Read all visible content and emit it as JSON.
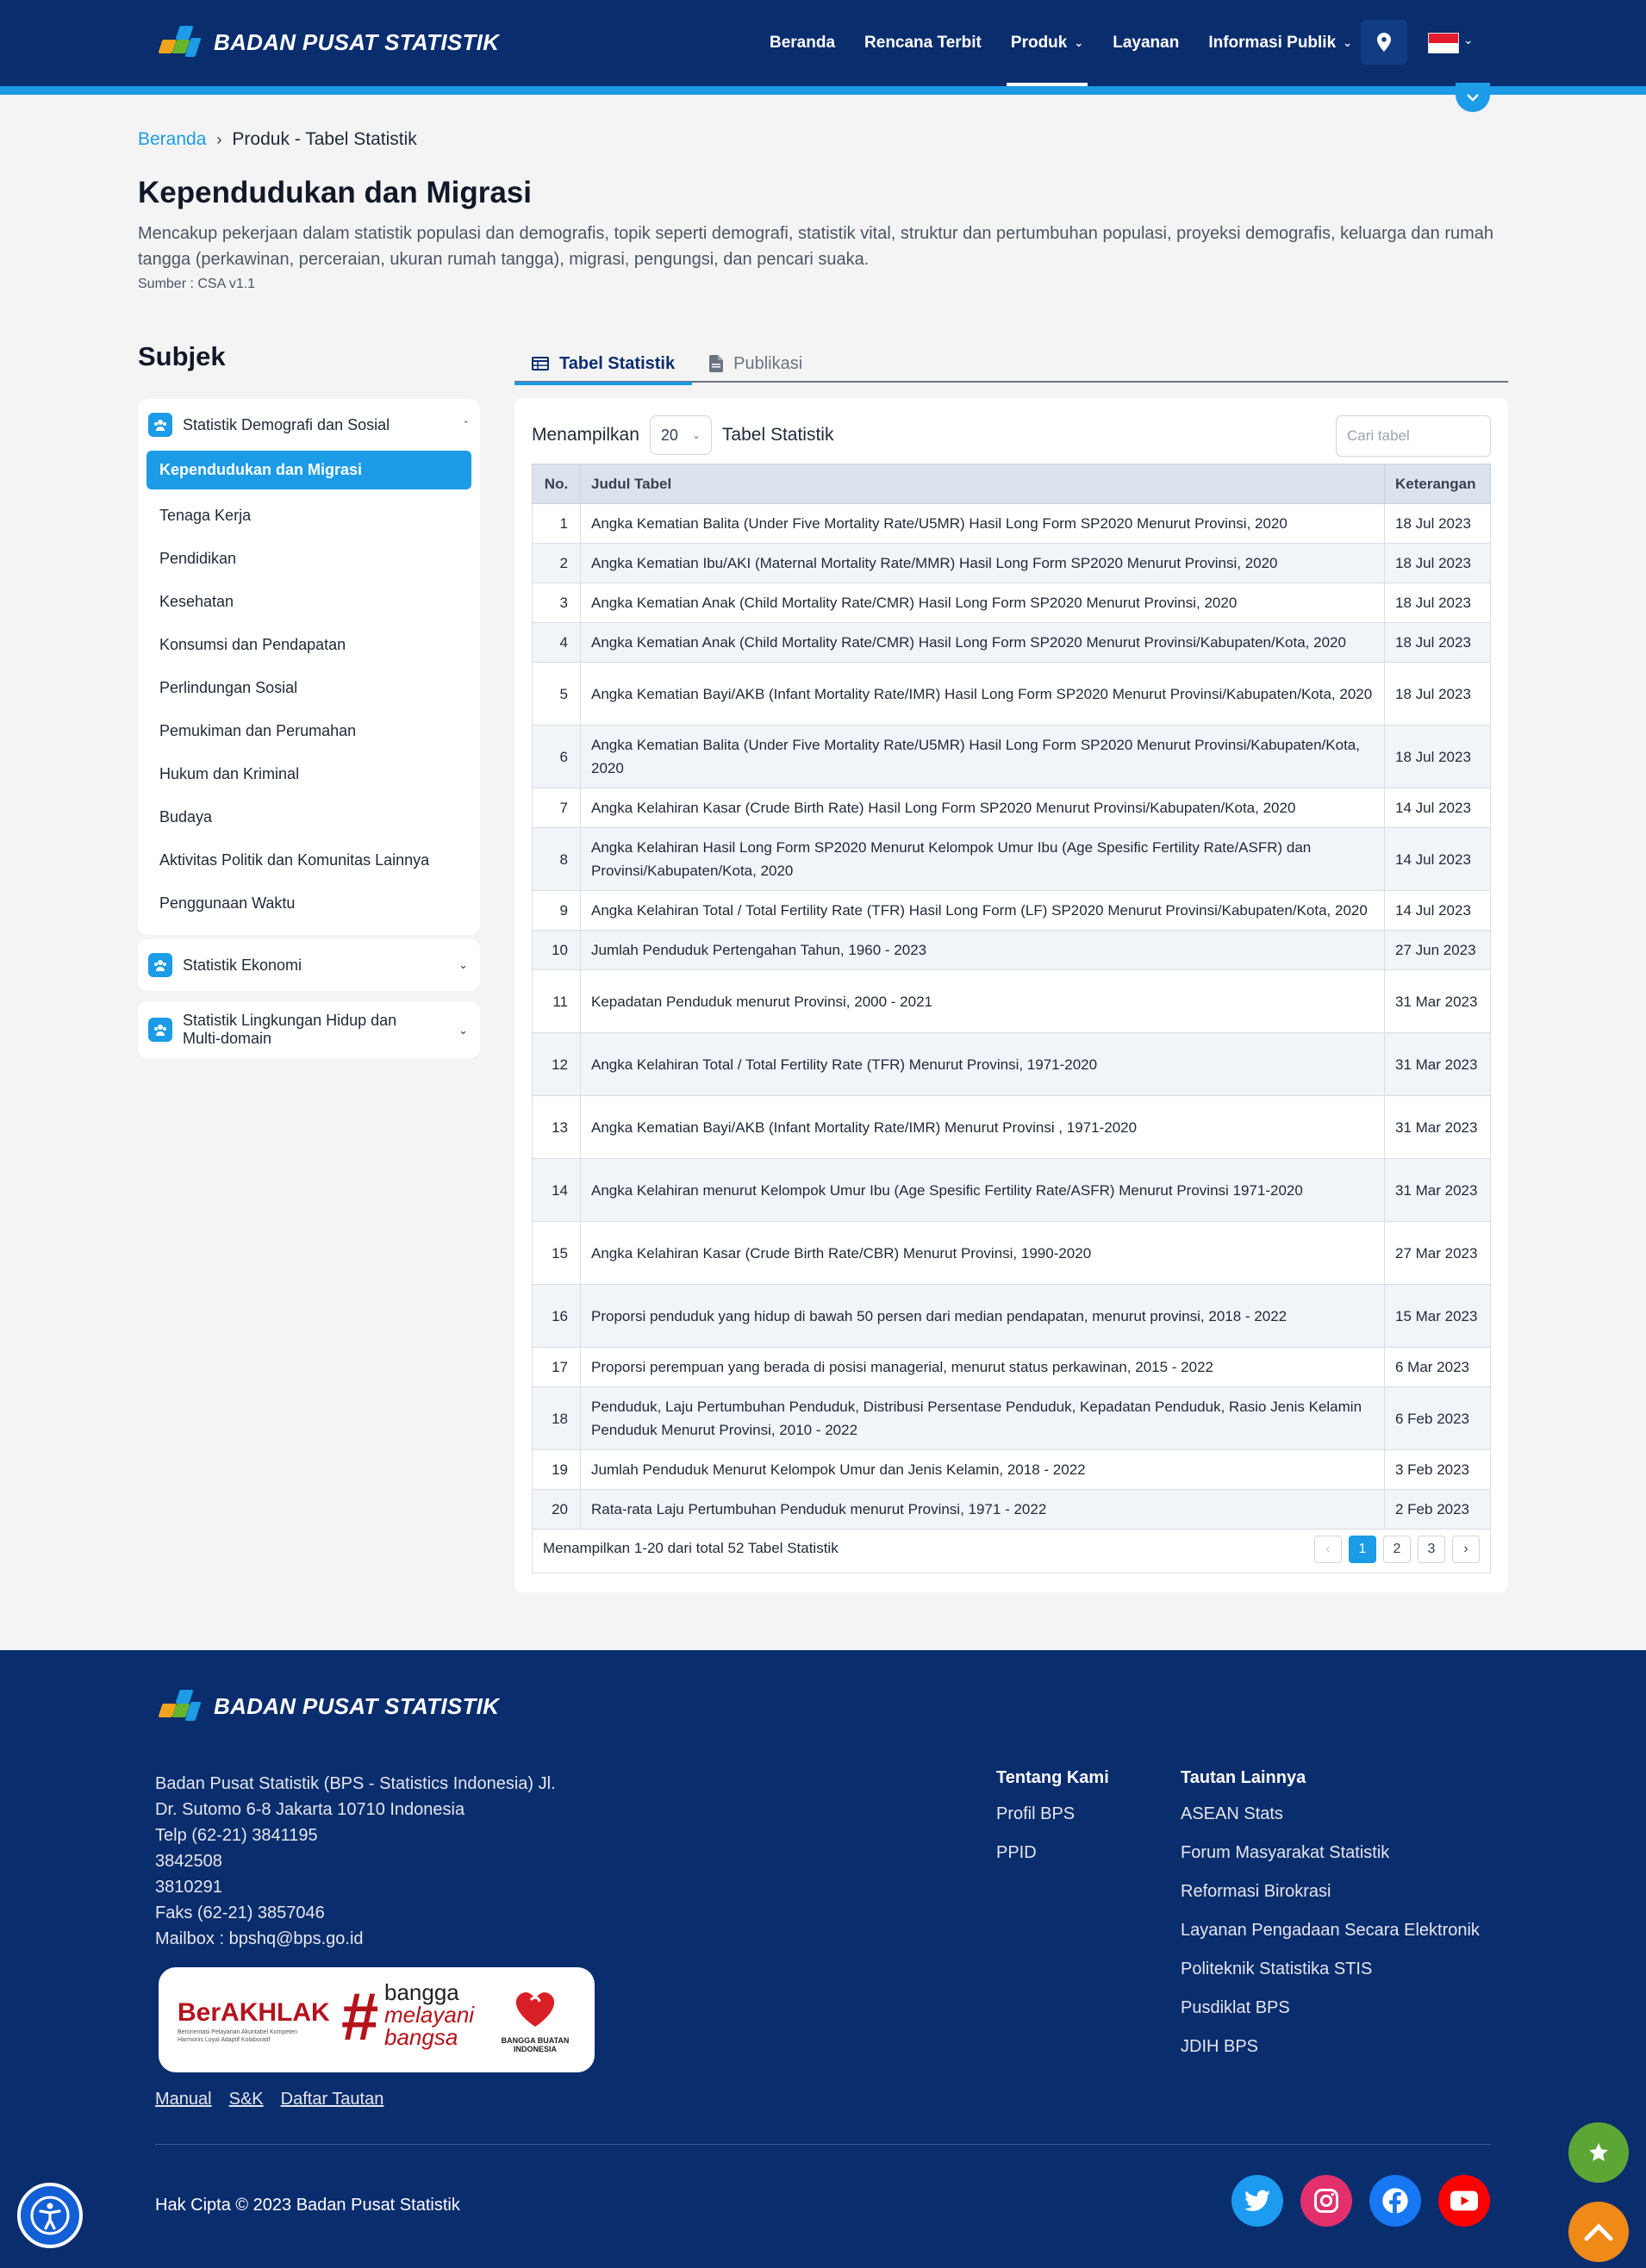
{
  "brand": {
    "name": "BADAN PUSAT STATISTIK"
  },
  "nav": {
    "items": [
      {
        "label": "Beranda"
      },
      {
        "label": "Rencana Terbit"
      },
      {
        "label": "Produk",
        "dropdown": true,
        "active": true
      },
      {
        "label": "Layanan"
      },
      {
        "label": "Informasi Publik",
        "dropdown": true
      }
    ],
    "language_flag": "indonesia-flag-icon"
  },
  "breadcrumb": {
    "home": "Beranda",
    "current": "Produk - Tabel Statistik"
  },
  "page": {
    "title": "Kependudukan dan Migrasi",
    "description": "Mencakup pekerjaan dalam statistik populasi dan demografis, topik seperti demografi, statistik vital, struktur dan pertumbuhan populasi, proyeksi demografis, keluarga dan rumah tangga (perkawinan, perceraian, ukuran rumah tangga), migrasi, pengungsi, dan pencari suaka.",
    "source": "Sumber : CSA v1.1"
  },
  "sidebar": {
    "title": "Subjek",
    "groups": [
      {
        "label": "Statistik Demografi dan Sosial",
        "expanded": true,
        "items": [
          {
            "label": "Kependudukan dan Migrasi",
            "active": true
          },
          {
            "label": "Tenaga Kerja"
          },
          {
            "label": "Pendidikan"
          },
          {
            "label": "Kesehatan"
          },
          {
            "label": "Konsumsi dan Pendapatan"
          },
          {
            "label": "Perlindungan Sosial"
          },
          {
            "label": "Pemukiman dan Perumahan"
          },
          {
            "label": "Hukum dan Kriminal"
          },
          {
            "label": "Budaya"
          },
          {
            "label": "Aktivitas Politik dan Komunitas Lainnya"
          },
          {
            "label": "Penggunaan Waktu"
          }
        ]
      },
      {
        "label": "Statistik Ekonomi",
        "expanded": false
      },
      {
        "label": "Statistik Lingkungan Hidup dan Multi-domain",
        "expanded": false
      }
    ]
  },
  "tabs": [
    {
      "label": "Tabel Statistik",
      "active": true
    },
    {
      "label": "Publikasi"
    }
  ],
  "table_controls": {
    "show_label": "Menampilkan",
    "per_page": "20",
    "suffix": "Tabel Statistik",
    "search_placeholder": "Cari tabel"
  },
  "table": {
    "headers": [
      "No.",
      "Judul Tabel",
      "Keterangan"
    ],
    "rows": [
      {
        "no": "1",
        "title": "Angka Kematian Balita (Under Five Mortality Rate/U5MR) Hasil Long Form SP2020 Menurut Provinsi, 2020",
        "date": "18 Jul 2023"
      },
      {
        "no": "2",
        "title": "Angka Kematian Ibu/AKI (Maternal Mortality Rate/MMR) Hasil Long Form SP2020 Menurut Provinsi, 2020",
        "date": "18 Jul 2023"
      },
      {
        "no": "3",
        "title": "Angka Kematian Anak (Child Mortality Rate/CMR) Hasil Long Form SP2020 Menurut Provinsi, 2020",
        "date": "18 Jul 2023"
      },
      {
        "no": "4",
        "title": "Angka Kematian Anak (Child Mortality Rate/CMR) Hasil Long Form SP2020 Menurut Provinsi/Kabupaten/Kota, 2020",
        "date": "18 Jul 2023"
      },
      {
        "no": "5",
        "title": "Angka Kematian Bayi/AKB (Infant Mortality Rate/IMR) Hasil Long Form SP2020 Menurut Provinsi/Kabupaten/Kota, 2020",
        "date": "18 Jul 2023"
      },
      {
        "no": "6",
        "title": "Angka Kematian Balita (Under Five Mortality Rate/U5MR) Hasil Long Form SP2020 Menurut Provinsi/Kabupaten/Kota, 2020",
        "date": "18 Jul 2023"
      },
      {
        "no": "7",
        "title": "Angka Kelahiran Kasar (Crude Birth Rate) Hasil Long Form SP2020 Menurut Provinsi/Kabupaten/Kota, 2020",
        "date": "14 Jul 2023"
      },
      {
        "no": "8",
        "title": "Angka Kelahiran Hasil Long Form SP2020 Menurut Kelompok Umur Ibu (Age Spesific Fertility Rate/ASFR) dan Provinsi/Kabupaten/Kota, 2020",
        "date": "14 Jul 2023"
      },
      {
        "no": "9",
        "title": "Angka Kelahiran Total / Total Fertility Rate (TFR) Hasil Long Form (LF) SP2020 Menurut Provinsi/Kabupaten/Kota, 2020",
        "date": "14 Jul 2023"
      },
      {
        "no": "10",
        "title": "Jumlah Penduduk Pertengahan Tahun, 1960 - 2023",
        "date": "27 Jun 2023"
      },
      {
        "no": "11",
        "title": "Kepadatan Penduduk menurut Provinsi, 2000 - 2021",
        "date": "31 Mar 2023"
      },
      {
        "no": "12",
        "title": "Angka Kelahiran Total / Total Fertility Rate (TFR) Menurut Provinsi, 1971-2020",
        "date": "31 Mar 2023"
      },
      {
        "no": "13",
        "title": "Angka Kematian Bayi/AKB (Infant Mortality Rate/IMR) Menurut Provinsi , 1971-2020",
        "date": "31 Mar 2023"
      },
      {
        "no": "14",
        "title": "Angka Kelahiran menurut Kelompok Umur Ibu (Age Spesific Fertility Rate/ASFR) Menurut Provinsi 1971-2020",
        "date": "31 Mar 2023"
      },
      {
        "no": "15",
        "title": "Angka Kelahiran Kasar (Crude Birth Rate/CBR) Menurut Provinsi, 1990-2020",
        "date": "27 Mar 2023"
      },
      {
        "no": "16",
        "title": "Proporsi penduduk yang hidup di bawah 50 persen dari median pendapatan, menurut provinsi, 2018 - 2022",
        "date": "15 Mar 2023"
      },
      {
        "no": "17",
        "title": "Proporsi perempuan yang berada di posisi managerial, menurut status perkawinan, 2015 - 2022",
        "date": "6 Mar 2023"
      },
      {
        "no": "18",
        "title": "Penduduk, Laju Pertumbuhan Penduduk, Distribusi Persentase Penduduk, Kepadatan Penduduk, Rasio Jenis Kelamin Penduduk Menurut Provinsi, 2010 - 2022",
        "date": "6 Feb 2023"
      },
      {
        "no": "19",
        "title": "Jumlah Penduduk Menurut Kelompok Umur dan Jenis Kelamin, 2018 - 2022",
        "date": "3 Feb 2023"
      },
      {
        "no": "20",
        "title": "Rata-rata Laju Pertumbuhan Penduduk menurut Provinsi, 1971 - 2022",
        "date": "2 Feb 2023"
      }
    ],
    "footer_text": "Menampilkan 1-20 dari total 52 Tabel Statistik",
    "pages": [
      "1",
      "2",
      "3"
    ],
    "current_page": "1"
  },
  "footer": {
    "brand": "BADAN PUSAT STATISTIK",
    "address_lines": [
      "Badan Pusat Statistik (BPS - Statistics Indonesia) Jl.",
      "Dr. Sutomo 6-8 Jakarta 10710 Indonesia",
      "Telp (62-21) 3841195",
      "3842508",
      "3810291",
      "Faks (62-21) 3857046",
      "Mailbox : bpshq@bps.go.id"
    ],
    "badge": {
      "berakhlak": "BerAKHLAK",
      "berakhlak_sub1": "Berorientasi Pelayanan Akuntabel Kompeten",
      "berakhlak_sub2": "Harmonis Loyal Adaptif Kolaboratif",
      "hash_line1": "bangga",
      "hash_line2": "melayani",
      "hash_line3": "bangsa",
      "bbi_line1": "BANGGA BUATAN",
      "bbi_line2": "INDONESIA"
    },
    "bottom_links": [
      "Manual",
      "S&K",
      "Daftar Tautan"
    ],
    "tentang": {
      "title": "Tentang Kami",
      "items": [
        "Profil BPS",
        "PPID"
      ]
    },
    "tautan": {
      "title": "Tautan Lainnya",
      "items": [
        "ASEAN Stats",
        "Forum Masyarakat Statistik",
        "Reformasi Birokrasi",
        "Layanan Pengadaan Secara Elektronik",
        "Politeknik Statistika STIS",
        "Pusdiklat BPS",
        "JDIH BPS"
      ]
    },
    "copyright": "Hak Cipta © 2023 Badan Pusat Statistik",
    "social": [
      {
        "icon": "twitter-icon",
        "color": "#1d9bf0"
      },
      {
        "icon": "instagram-icon",
        "color": "#e1306c"
      },
      {
        "icon": "facebook-icon",
        "color": "#1877f2"
      },
      {
        "icon": "youtube-icon",
        "color": "#ff0000"
      }
    ]
  },
  "colors": {
    "navy": "#0a2d6e",
    "accent": "#1c9be6",
    "fav": "#5da636",
    "scroll_top": "#ef8a17"
  }
}
